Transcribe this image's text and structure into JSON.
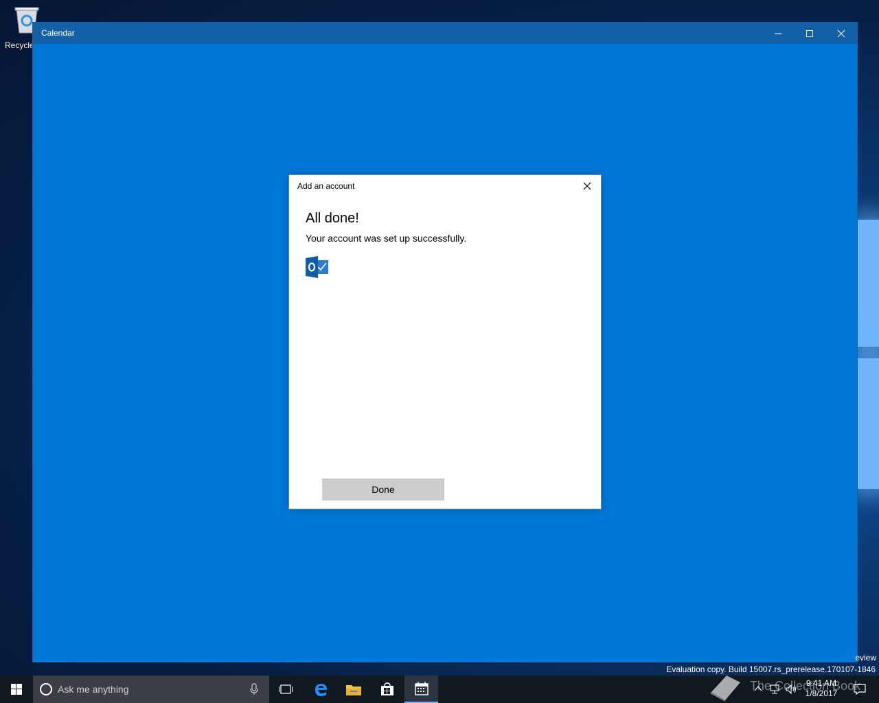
{
  "desktop": {
    "recycle_bin_label": "Recycle"
  },
  "window": {
    "title": "Calendar",
    "controls": [
      "minimize",
      "maximize",
      "close"
    ]
  },
  "dialog": {
    "title": "Add an account",
    "heading": "All done!",
    "message": "Your account was set up successfully.",
    "account_icon": "outlook-icon",
    "done_label": "Done"
  },
  "watermark": {
    "build_text": "Evaluation copy. Build 15007.rs_prerelease.170107-1846",
    "partial_text": "eview"
  },
  "taskbar": {
    "search_placeholder": "Ask me anything",
    "apps": [
      "task-view-icon",
      "edge-icon",
      "file-explorer-icon",
      "store-icon",
      "calendar-icon"
    ],
    "active_app": "calendar-icon",
    "overlay_text": "The Collection Book",
    "time": "9:41 AM",
    "date": "1/8/2017"
  },
  "colors": {
    "accent": "#0078d7",
    "titlebar": "#1460a6",
    "taskbar": "#101820",
    "button": "#cccccc"
  }
}
